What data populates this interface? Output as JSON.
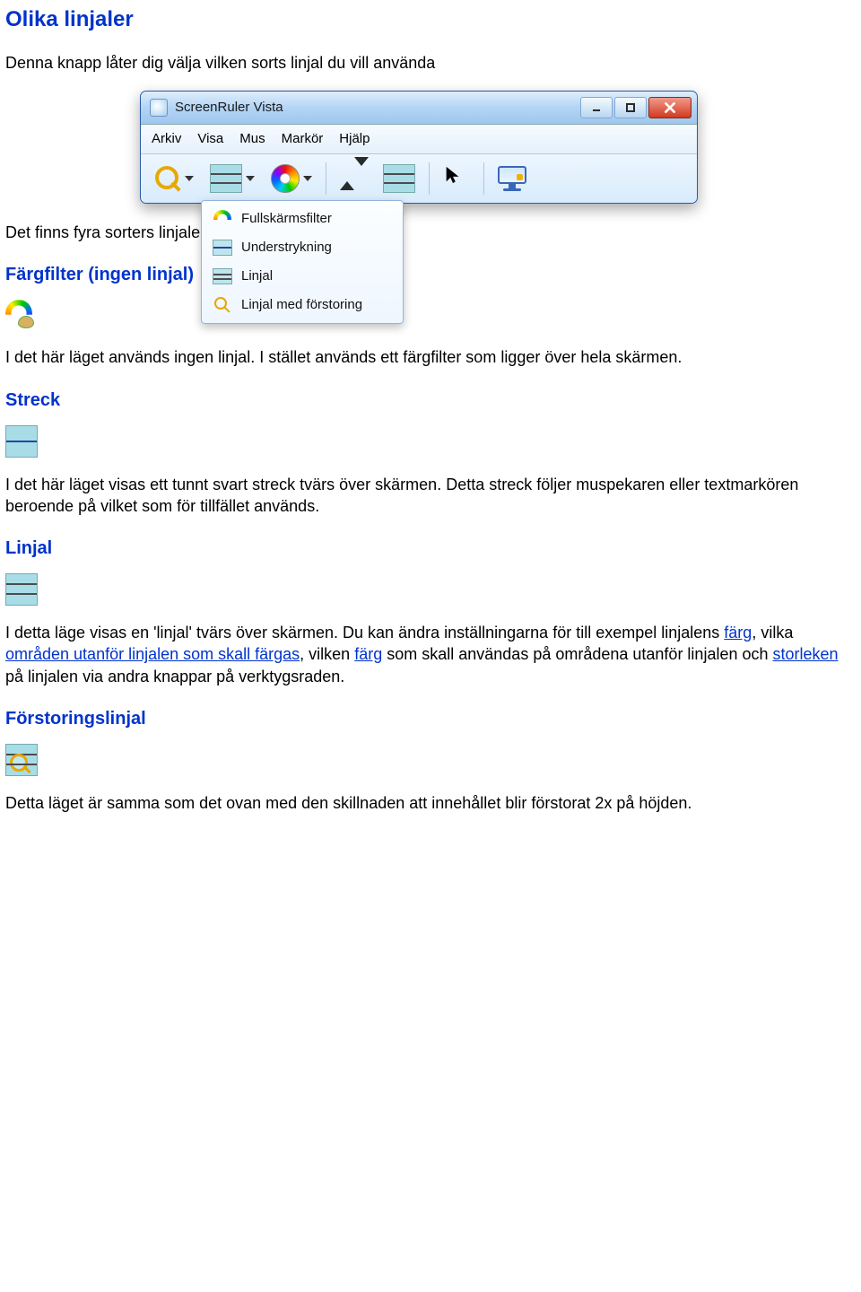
{
  "headings": {
    "main": "Olika linjaler",
    "fargfilter": "Färgfilter (ingen linjal)",
    "streck": "Streck",
    "linjal": "Linjal",
    "forstoring": "Förstoringslinjal"
  },
  "paragraphs": {
    "intro": "Denna knapp låter dig välja vilken sorts linjal du vill använda",
    "four_types": "Det finns fyra sorters linjaler:",
    "fargfilter_body": "I det här läget används ingen linjal. I stället används ett färgfilter som ligger över hela skärmen.",
    "streck_body": "I det här läget visas ett tunnt svart streck tvärs över skärmen. Detta streck följer muspekaren eller textmarkören beroende på vilket som för tillfället används.",
    "linjal_pre": "I detta läge visas en 'linjal' tvärs över skärmen. Du kan ändra inställningarna för till exempel linjalens ",
    "linjal_mid1": ", vilka ",
    "linjal_mid2": ", vilken ",
    "linjal_mid3": " som skall användas på områdena utanför linjalen och ",
    "linjal_post": " på linjalen via andra knappar på verktygsraden.",
    "forstoring_body": "Detta läget är samma som det ovan med den skillnaden att innehållet blir förstorat 2x på höjden."
  },
  "links": {
    "farg": "färg",
    "omraden": "områden utanför linjalen som skall färgas",
    "farg2": "färg",
    "storleken": "storleken"
  },
  "window": {
    "title": "ScreenRuler Vista",
    "menu": [
      "Arkiv",
      "Visa",
      "Mus",
      "Markör",
      "Hjälp"
    ],
    "dropdown": {
      "fullscreen": "Fullskärmsfilter",
      "underline": "Understrykning",
      "ruler": "Linjal",
      "ruler_mag": "Linjal med förstoring"
    }
  }
}
